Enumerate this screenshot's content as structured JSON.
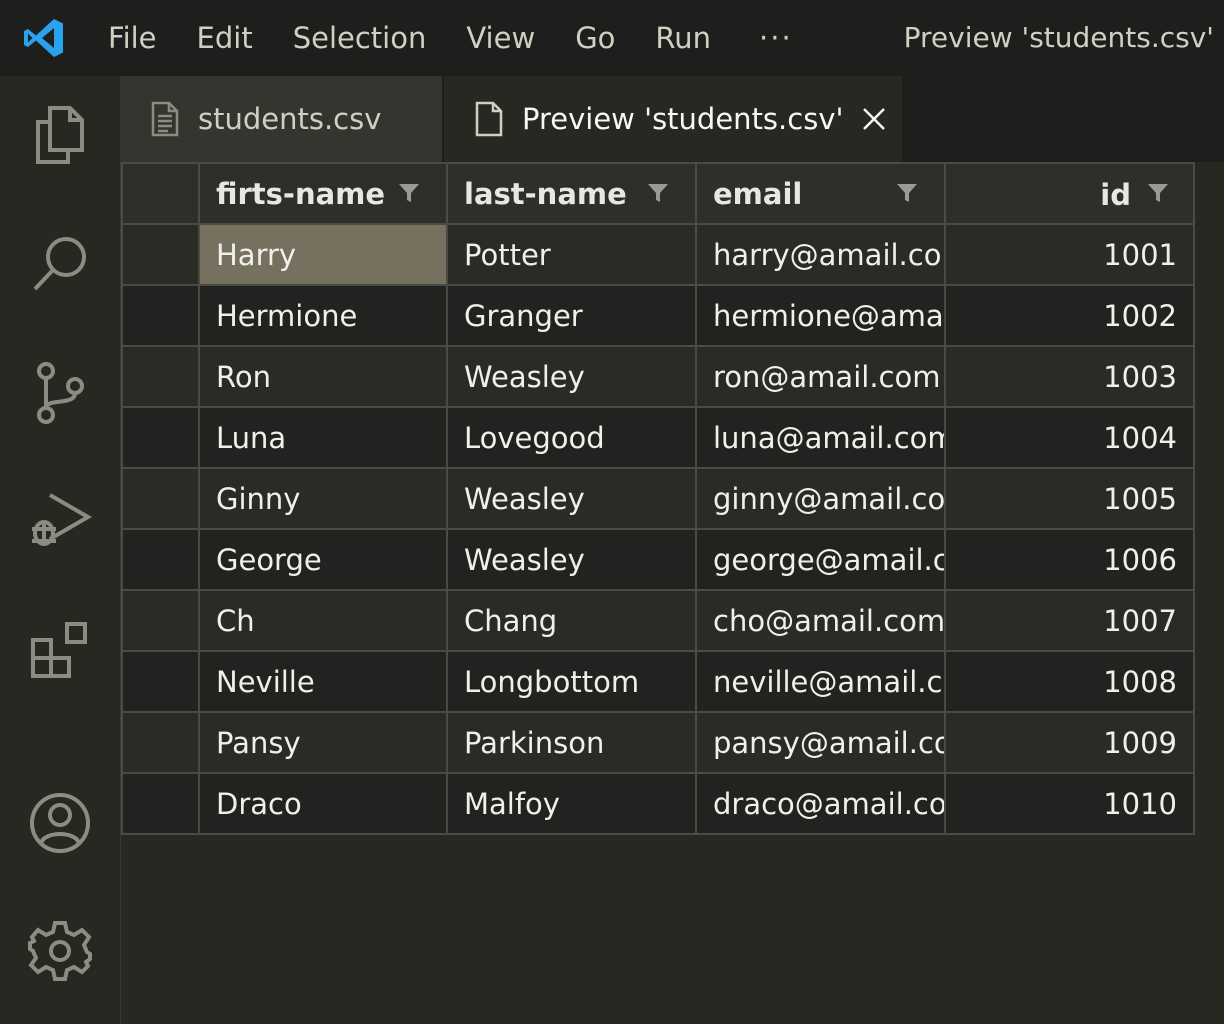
{
  "menu": {
    "items": [
      "File",
      "Edit",
      "Selection",
      "View",
      "Go",
      "Run"
    ],
    "more": "···",
    "window_title": "Preview 'students.csv'"
  },
  "activity": {
    "items": [
      "explorer-icon",
      "search-icon",
      "source-control-icon",
      "run-debug-icon",
      "extensions-icon",
      "account-icon",
      "settings-gear-icon"
    ]
  },
  "tabs": [
    {
      "label": "students.csv",
      "icon": "file-lines-icon",
      "active": false
    },
    {
      "label": "Preview 'students.csv'",
      "icon": "file-icon",
      "active": true,
      "close": "close-icon"
    }
  ],
  "table": {
    "headers": [
      "firts-name",
      "last-name",
      "email",
      "id"
    ],
    "rows": [
      [
        "Harry",
        "Potter",
        "harry@amail.com",
        "1001"
      ],
      [
        "Hermione",
        "Granger",
        "hermione@amail.com",
        "1002"
      ],
      [
        "Ron",
        "Weasley",
        "ron@amail.com",
        "1003"
      ],
      [
        "Luna",
        "Lovegood",
        "luna@amail.com",
        "1004"
      ],
      [
        "Ginny",
        "Weasley",
        "ginny@amail.com",
        "1005"
      ],
      [
        "George",
        "Weasley",
        "george@amail.com",
        "1006"
      ],
      [
        "Ch",
        "Chang",
        "cho@amail.com",
        "1007"
      ],
      [
        "Neville",
        "Longbottom",
        "neville@amail.com",
        "1008"
      ],
      [
        "Pansy",
        "Parkinson",
        "pansy@amail.com",
        "1009"
      ],
      [
        "Draco",
        "Malfoy",
        "draco@amail.com",
        "1010"
      ]
    ],
    "selected_cell": "Harry"
  },
  "colors": {
    "background": "#272822",
    "titlebar": "#1e1f1c",
    "selection": "#75715e",
    "vscode_blue": "#2aa3ef"
  }
}
